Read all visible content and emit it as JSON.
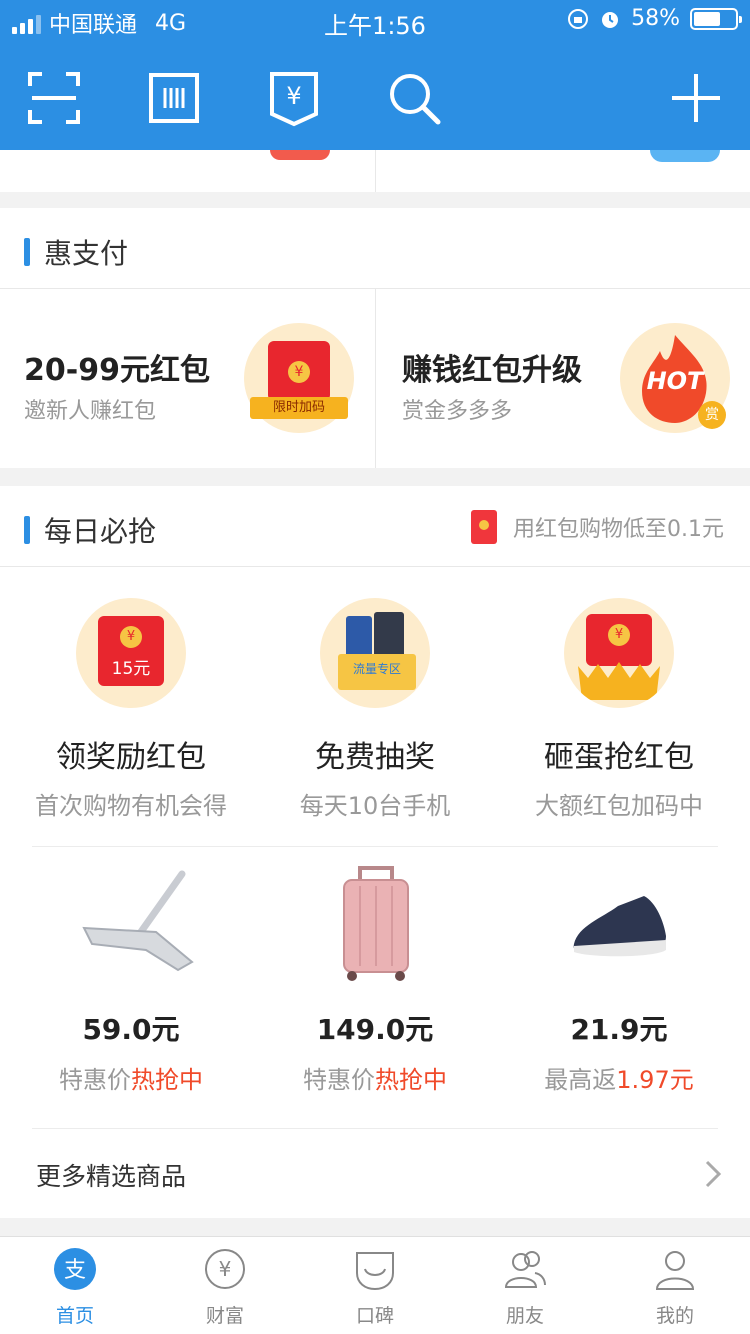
{
  "status": {
    "carrier": "中国联通",
    "network": "4G",
    "time": "上午1:56",
    "battery": "58%"
  },
  "toolbar": {
    "scan_icon": "scan-icon",
    "paycode_icon": "barcode-icon",
    "collect_icon": "collect-money-icon",
    "search_icon": "search-icon",
    "add_icon": "plus-icon"
  },
  "hui_pay": {
    "title": "惠支付",
    "left": {
      "title": "20-99元红包",
      "sub": "邀新人赚红包",
      "badge": "限时加码"
    },
    "right": {
      "title": "赚钱红包升级",
      "sub": "赏金多多多",
      "badge": "HOT",
      "badge2": "赏"
    }
  },
  "daily": {
    "title": "每日必抢",
    "hint": "用红包购物低至0.1元",
    "items": [
      {
        "name": "领奖励红包",
        "desc": "首次购物有机会得",
        "amount": "15元"
      },
      {
        "name": "免费抽奖",
        "desc": "每天10台手机",
        "badge": "流量专区"
      },
      {
        "name": "砸蛋抢红包",
        "desc": "大额红包加码中"
      }
    ],
    "products": [
      {
        "price": "59.0元",
        "tag_prefix": "特惠价",
        "tag_highlight": "热抢中"
      },
      {
        "price": "149.0元",
        "tag_prefix": "特惠价",
        "tag_highlight": "热抢中"
      },
      {
        "price": "21.9元",
        "tag_prefix": "最高返",
        "tag_highlight": "1.97元"
      }
    ],
    "more": "更多精选商品"
  },
  "tabs": [
    {
      "label": "首页",
      "icon": "alipay-icon",
      "active": true
    },
    {
      "label": "财富",
      "icon": "yuan-circle-icon"
    },
    {
      "label": "口碑",
      "icon": "koubei-icon"
    },
    {
      "label": "朋友",
      "icon": "friends-icon"
    },
    {
      "label": "我的",
      "icon": "person-icon"
    }
  ],
  "colors": {
    "brand": "#2c8fe3",
    "highlight": "#f04a2a"
  }
}
